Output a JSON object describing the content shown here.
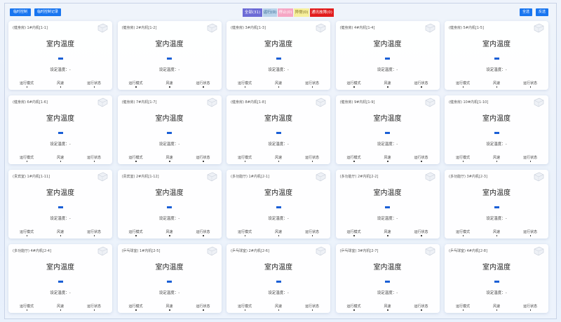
{
  "toolbar": {
    "btn_left1": "临时控制",
    "btn_left2": "临时控制记录",
    "btn_right1": "全选",
    "btn_right2": "反选"
  },
  "status_filters": [
    {
      "label": "全部(31)",
      "bg": "#6c6bd6",
      "fg": "#ffffff"
    },
    {
      "label": "运行(0)",
      "bg": "#b9d3ea",
      "fg": "#2b5c8a"
    },
    {
      "label": "停止(0)",
      "bg": "#f6a6c4",
      "fg": "#ffffff"
    },
    {
      "label": "异常(0)",
      "bg": "#f6ef9b",
      "fg": "#7a6a20"
    },
    {
      "label": "通讯故障(0)",
      "bg": "#e21d1d",
      "fg": "#ffffff"
    }
  ],
  "card_labels": {
    "temp_title": "室内温度",
    "set_temp": "设定温度：-",
    "mode": "运行模式",
    "wind": "风速",
    "state": "运行状态"
  },
  "cards": [
    {
      "title": "(健身房) 1#内机[1-1]"
    },
    {
      "title": "(健身房) 2#内机[1-2]"
    },
    {
      "title": "(健身房) 3#内机[1-3]"
    },
    {
      "title": "(健身房) 4#内机[1-4]"
    },
    {
      "title": "(健身房) 5#内机[1-5]"
    },
    {
      "title": "(健身房) 6#内机[1-6]"
    },
    {
      "title": "(健身房) 7#内机[1-7]"
    },
    {
      "title": "(健身房) 8#内机[1-8]"
    },
    {
      "title": "(健身房) 9#内机[1-9]"
    },
    {
      "title": "(健身房) 10#内机[1-10]"
    },
    {
      "title": "(贵宾室) 1#内机[1-11]"
    },
    {
      "title": "(贵宾室) 2#内机[1-12]"
    },
    {
      "title": "(多功能厅) 1#内机[2-1]"
    },
    {
      "title": "(多功能厅) 2#内机[2-2]"
    },
    {
      "title": "(多功能厅) 3#内机[2-3]"
    },
    {
      "title": "(多功能厅) 4#内机[2-4]"
    },
    {
      "title": "(乒乓球室) 1#内机[2-5]"
    },
    {
      "title": "(乒乓球室) 2#内机[2-6]"
    },
    {
      "title": "(乒乓球室) 3#内机[2-7]"
    },
    {
      "title": "(乒乓球室) 4#内机[2-8]"
    }
  ]
}
